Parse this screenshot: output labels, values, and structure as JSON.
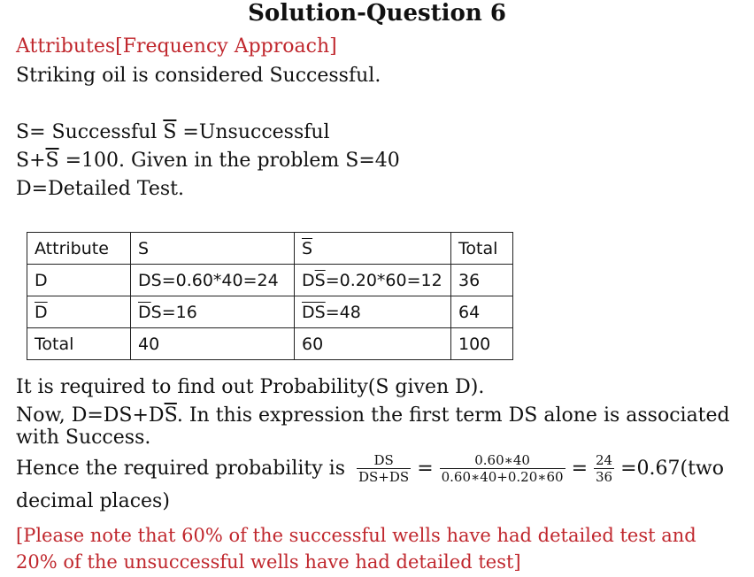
{
  "title": "Solution-Question 6",
  "subtitle": "Attributes[Frequency Approach]",
  "line1": "Striking oil is considered Successful.",
  "defs": {
    "s_def": "S= Successful ",
    "sbar": "S",
    "sbar_def": " =Unsuccessful"
  },
  "given": {
    "pre": "S+",
    "sbar": "S",
    "post": " =100. Given in the problem S=40"
  },
  "d_def": "D=Detailed Test.",
  "table": {
    "header": {
      "c0": "Attribute",
      "c1": "S",
      "c2": "S",
      "c3": "Total"
    },
    "row1": {
      "c0": "D",
      "c1": "DS=0.60*40=24",
      "c2_pre": "D",
      "c2_bar": "S",
      "c2_post": "=0.20*60=12",
      "c3": "36"
    },
    "row2": {
      "c0": "D",
      "c1_bar": "D",
      "c1_post": "S=16",
      "c2_bar": "DS",
      "c2_post": "=48",
      "c3": "64"
    },
    "row3": {
      "c0": "Total",
      "c1": "40",
      "c2": "60",
      "c3": "100"
    }
  },
  "req": "It is required to find out Probability(S given D).",
  "now": {
    "pre": "Now, D=DS+D",
    "bar": "S",
    "post": ". In this expression the first term DS alone is associated"
  },
  "with_success": "with Success.",
  "hence": {
    "pre": "Hence the required probability is",
    "f1_num": "DS",
    "f1_den_pre": "DS+D",
    "f1_den_bar": "S",
    "eq1": "=",
    "f2_num": "0.60∗40",
    "f2_den": "0.60∗40+0.20∗60",
    "eq2": "=",
    "f3_num": "24",
    "f3_den": "36",
    "result": "=0.67(two"
  },
  "decimal": "decimal places)",
  "note1": "[Please note that 60% of the successful wells have had detailed test and",
  "note2": "20% of the unsuccessful wells have had detailed test]"
}
